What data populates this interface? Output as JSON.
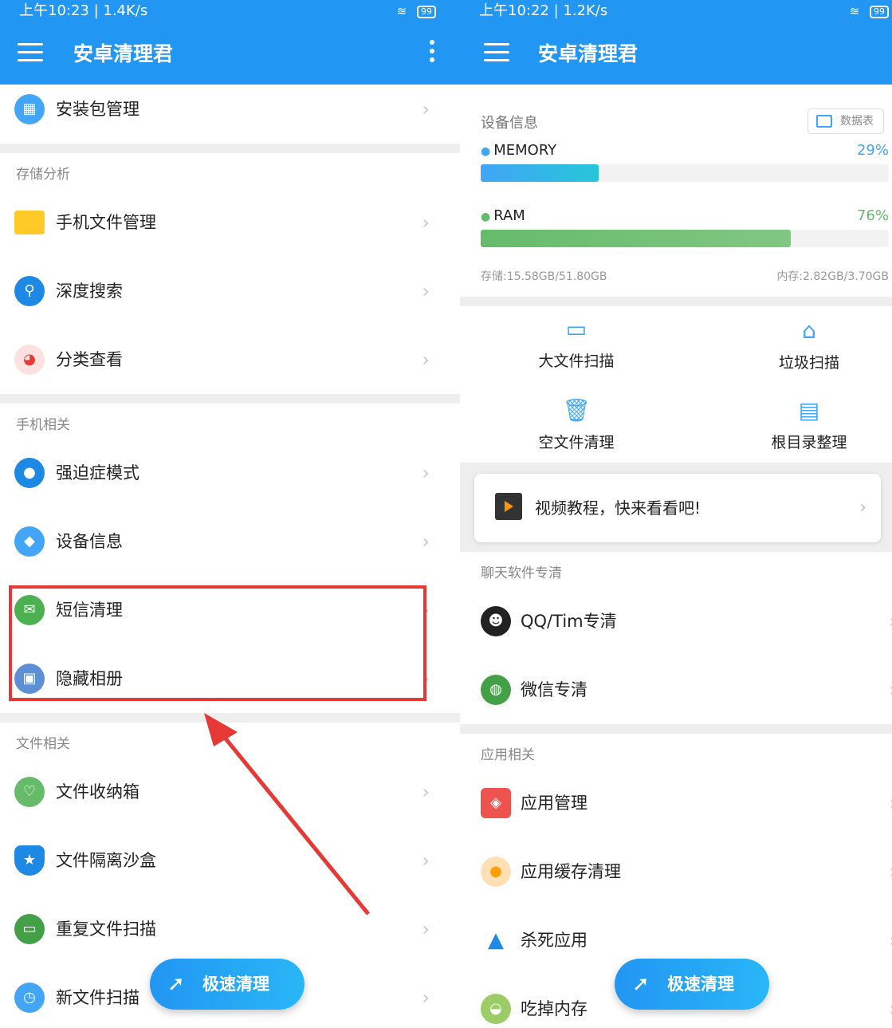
{
  "colors": {
    "primary": "#2196f3",
    "highlight": "#e53935",
    "memory": "#42a5f5",
    "ram": "#66bb6a"
  },
  "left": {
    "status": {
      "time": "上午10:23 | 1.4K/s",
      "battery": "99"
    },
    "app_title": "安卓清理君",
    "top_item": {
      "label": "安装包管理",
      "icon": "apps-grid-icon"
    },
    "sections": {
      "storage": "存储分析",
      "phone": "手机相关",
      "files": "文件相关"
    },
    "storage_items": [
      {
        "label": "手机文件管理",
        "icon": "folder-icon"
      },
      {
        "label": "深度搜索",
        "icon": "deep-search-icon"
      },
      {
        "label": "分类查看",
        "icon": "pie-chart-icon"
      }
    ],
    "phone_items": [
      {
        "label": "强迫症模式",
        "icon": "toggle-icon"
      },
      {
        "label": "设备信息",
        "icon": "device-icon"
      },
      {
        "label": "短信清理",
        "icon": "message-icon"
      },
      {
        "label": "隐藏相册",
        "icon": "image-icon"
      }
    ],
    "file_items": [
      {
        "label": "文件收纳箱",
        "icon": "heart-box-icon"
      },
      {
        "label": "文件隔离沙盒",
        "icon": "shield-icon"
      },
      {
        "label": "重复文件扫描",
        "icon": "duplicate-file-icon"
      },
      {
        "label": "新文件扫描",
        "icon": "clock-icon"
      }
    ],
    "fab": "极速清理"
  },
  "right": {
    "status": {
      "time": "上午10:22 | 1.2K/s",
      "battery": "99"
    },
    "app_title": "安卓清理君",
    "device": {
      "title": "设备信息",
      "chip": "数据表",
      "memory_label": "MEMORY",
      "memory_pct_text": "29%",
      "memory_fraction": 0.29,
      "ram_label": "RAM",
      "ram_pct_text": "76%",
      "ram_fraction": 0.76,
      "storage_text": "存储:15.58GB/51.80GB",
      "ram_text": "内存:2.82GB/3.70GB"
    },
    "tools": [
      {
        "label": "大文件扫描",
        "icon": "folder-outline-icon"
      },
      {
        "label": "垃圾扫描",
        "icon": "broom-icon"
      },
      {
        "label": "空文件清理",
        "icon": "trash-icon"
      },
      {
        "label": "根目录整理",
        "icon": "toolbox-icon"
      }
    ],
    "video": "视频教程，快来看看吧!",
    "sections": {
      "chat": "聊天软件专清",
      "apps": "应用相关"
    },
    "chat_items": [
      {
        "label": "QQ/Tim专清",
        "icon": "qq-penguin-icon"
      },
      {
        "label": "微信专清",
        "icon": "wechat-icon"
      }
    ],
    "app_items": [
      {
        "label": "应用管理",
        "icon": "cube-icon"
      },
      {
        "label": "应用缓存清理",
        "icon": "cache-icon"
      },
      {
        "label": "杀死应用",
        "icon": "rocket-icon"
      },
      {
        "label": "吃掉内存",
        "icon": "memory-eat-icon"
      }
    ],
    "fab": "极速清理"
  }
}
